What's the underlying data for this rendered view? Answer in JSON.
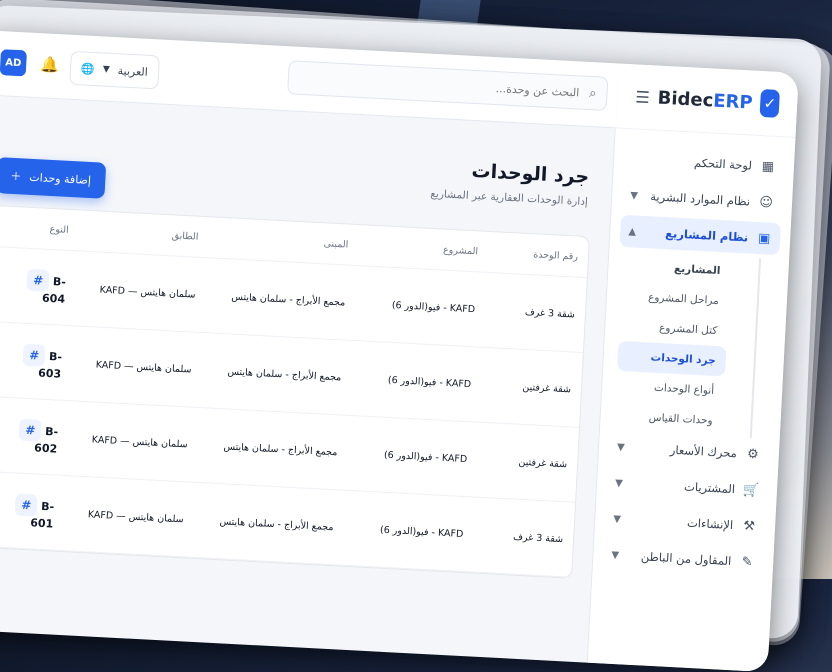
{
  "app": {
    "brand_a": "Bidec",
    "brand_b": "ERP"
  },
  "topbar": {
    "search_placeholder": "البحث عن وحدة...",
    "language": "العربية",
    "avatar": "AD"
  },
  "sidebar": {
    "items": [
      {
        "label": "لوحة التحكم"
      },
      {
        "label": "نظام الموارد البشرية"
      },
      {
        "label": "نظام المشاريع"
      }
    ],
    "sub_items": [
      {
        "label": "المشاريع"
      },
      {
        "label": "مراحل المشروع"
      },
      {
        "label": "كتل المشروع"
      },
      {
        "label": "جرد الوحدات"
      },
      {
        "label": "أنواع الوحدات"
      },
      {
        "label": "وحدات القياس"
      }
    ],
    "more_items": [
      {
        "label": "محرك الأسعار"
      },
      {
        "label": "المشتريات"
      },
      {
        "label": "الإنشاءات"
      },
      {
        "label": "المقاول من الباطن"
      }
    ]
  },
  "main": {
    "title": "جرد الوحدات",
    "subtitle": "إدارة الوحدات العقارية عبر المشاريع",
    "add_button": "إضافة وحدات",
    "columns": [
      "رقم الوحدة",
      "المشروع",
      "المبنى",
      "الطابق",
      "النوع"
    ],
    "rows": [
      {
        "type_label": "شقة 3 غرف",
        "project": "KAFD - فيو(الدور 6)",
        "building": "مجمع الأبراج - سلمان هايتس",
        "floor": "سلمان هايتس — KAFD",
        "unit": "B-604"
      },
      {
        "type_label": "شقة غرفتين",
        "project": "KAFD - فيو(الدور 6)",
        "building": "مجمع الأبراج - سلمان هايتس",
        "floor": "سلمان هايتس — KAFD",
        "unit": "B-603"
      },
      {
        "type_label": "شقة غرفتين",
        "project": "KAFD - فيو(الدور 6)",
        "building": "مجمع الأبراج - سلمان هايتس",
        "floor": "سلمان هايتس — KAFD",
        "unit": "B-602"
      },
      {
        "type_label": "شقة 3 غرف",
        "project": "KAFD - فيو(الدور 6)",
        "building": "مجمع الأبراج - سلمان هايتس",
        "floor": "سلمان هايتس — KAFD",
        "unit": "B-601"
      }
    ]
  },
  "colors": {
    "accent": "#2563eb",
    "active_bg": "#e8efff"
  }
}
